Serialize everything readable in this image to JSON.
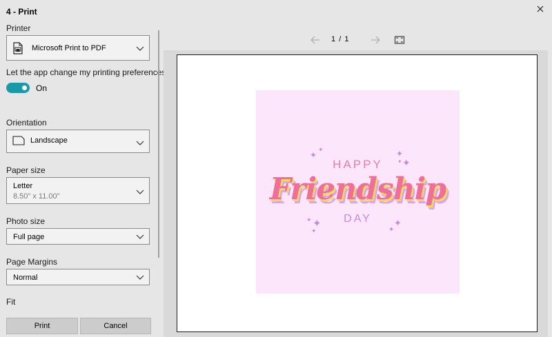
{
  "window": {
    "title": "4 - Print"
  },
  "printer": {
    "label": "Printer",
    "value": "Microsoft Print to PDF"
  },
  "preferences": {
    "label": "Let the app change my printing preferences",
    "state": "On"
  },
  "orientation": {
    "label": "Orientation",
    "value": "Landscape"
  },
  "paper_size": {
    "label": "Paper size",
    "value": "Letter",
    "detail": "8.50\" x 11.00\""
  },
  "photo_size": {
    "label": "Photo size",
    "value": "Full page"
  },
  "margins": {
    "label": "Page Margins",
    "value": "Normal"
  },
  "fit": {
    "label": "Fit"
  },
  "buttons": {
    "print": "Print",
    "cancel": "Cancel"
  },
  "pager": {
    "current": "1",
    "separator": "/",
    "total": "1"
  },
  "artwork": {
    "line1": "HAPPY",
    "line2": "Friendship",
    "line3": "DAY"
  },
  "colors": {
    "accent": "#1a9aa8",
    "card": "#fbe6fb",
    "pink": "#ee6f97",
    "lilac": "#c48adb",
    "yellow": "#f7d95c"
  }
}
